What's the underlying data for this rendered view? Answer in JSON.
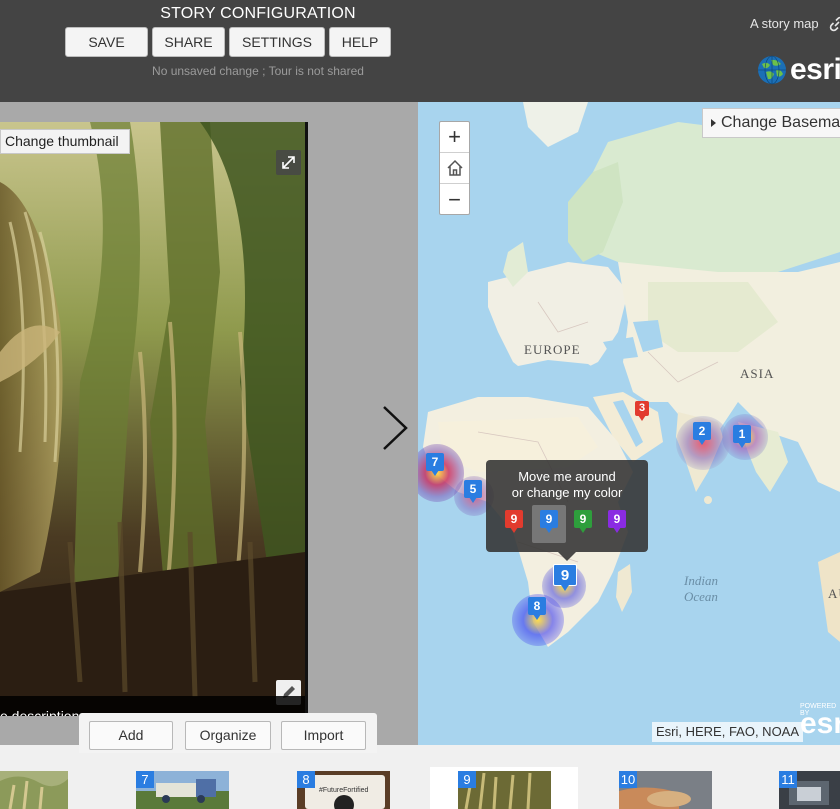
{
  "header": {
    "title": "STORY CONFIGURATION",
    "buttons": {
      "save": "SAVE",
      "share": "SHARE",
      "settings": "SETTINGS",
      "help": "HELP"
    },
    "status": "No unsaved change ; Tour is not shared",
    "story_map_label": "A story map",
    "esri_logo_text": "esri"
  },
  "media": {
    "change_thumbnail": "Change thumbnail",
    "caption": "e description"
  },
  "map": {
    "basemap_button": "Change Basema",
    "zoom_in": "+",
    "zoom_out": "−",
    "labels": {
      "europe": "EUROPE",
      "asia": "ASIA",
      "ocean_line1": "Indian",
      "ocean_line2": "Ocean",
      "right_edge": "AU"
    },
    "attribution": "Esri, HERE, FAO, NOAA",
    "powered_by": "POWERED BY",
    "logo_text": "esri",
    "markers": [
      {
        "number": "1",
        "color": "#2a7de1"
      },
      {
        "number": "2",
        "color": "#2a7de1"
      },
      {
        "number": "3",
        "color": "#e23b2e"
      },
      {
        "number": "5",
        "color": "#2a7de1"
      },
      {
        "number": "7",
        "color": "#2a7de1"
      },
      {
        "number": "8",
        "color": "#2a7de1"
      },
      {
        "number": "9",
        "color": "#2a7de1"
      }
    ],
    "popup": {
      "line1": "Move me around",
      "line2": "or change my color",
      "options": [
        {
          "number": "9",
          "color": "#e23b2e"
        },
        {
          "number": "9",
          "color": "#2a7de1"
        },
        {
          "number": "9",
          "color": "#2e9e3c"
        },
        {
          "number": "9",
          "color": "#8a2be2"
        }
      ],
      "selected_index": 1
    }
  },
  "tray": {
    "add": "Add",
    "organize": "Organize",
    "import": "Import"
  },
  "thumbnails": [
    {
      "number": "7"
    },
    {
      "number": "8"
    },
    {
      "number": "9"
    },
    {
      "number": "10"
    },
    {
      "number": "11"
    }
  ]
}
